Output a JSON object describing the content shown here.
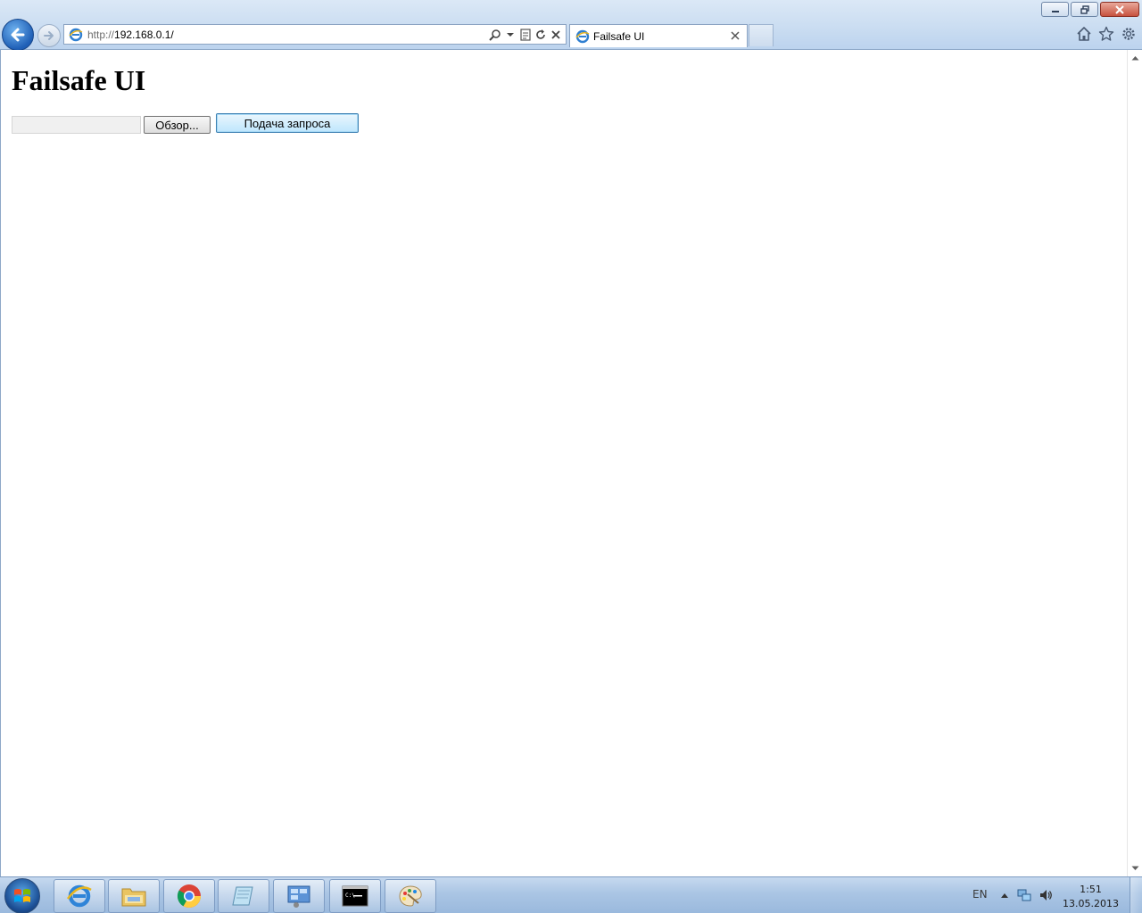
{
  "window": {
    "minimize_label": "–",
    "maximize_label": "❐",
    "close_label": "✕"
  },
  "browser": {
    "address": {
      "protocol": "http://",
      "host_path": "192.168.0.1/"
    },
    "tab": {
      "title": "Failsafe UI"
    }
  },
  "page": {
    "heading": "Failsafe UI",
    "file_input_value": "",
    "browse_label": "Обзор...",
    "submit_label": "Подача запроса"
  },
  "taskbar": {
    "language": "EN",
    "clock_time": "1:51",
    "clock_date": "13.05.2013",
    "apps": [
      "internet-explorer",
      "windows-explorer",
      "chrome",
      "notepad",
      "control-panel",
      "command-prompt",
      "paint"
    ]
  },
  "colors": {
    "chrome_bg": "#c9dcf1",
    "accent_blue": "#1f5fb6",
    "page_bg": "#ffffff",
    "submit_border": "#3c7fb1"
  }
}
